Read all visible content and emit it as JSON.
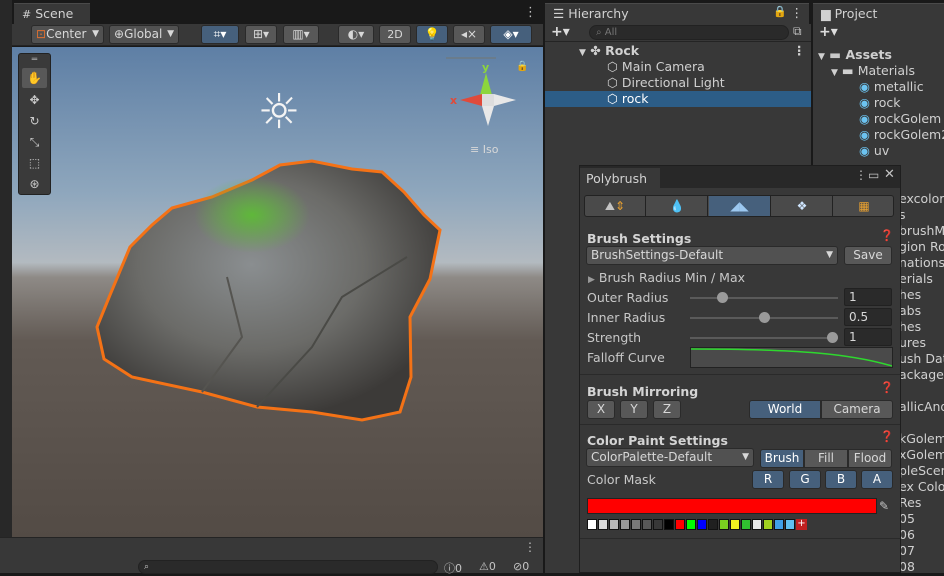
{
  "scene": {
    "tab_label": "Scene",
    "toolbar": {
      "pivot": "Center",
      "space": "Global",
      "mode_2d": "2D"
    },
    "gizmo": {
      "iso_label": "Iso",
      "y": "y",
      "x": "x"
    }
  },
  "hierarchy": {
    "tab_label": "Hierarchy",
    "search_placeholder": "All",
    "items": [
      {
        "label": "Rock"
      },
      {
        "label": "Main Camera"
      },
      {
        "label": "Directional Light"
      },
      {
        "label": "rock"
      }
    ]
  },
  "project": {
    "tab_label": "Project",
    "tree": [
      {
        "label": "Assets"
      },
      {
        "label": "Materials"
      },
      {
        "label": "metallic"
      },
      {
        "label": "rock"
      },
      {
        "label": "rockGolem"
      },
      {
        "label": "rockGolem2"
      },
      {
        "label": "uv"
      }
    ],
    "partial_items": [
      "excolor",
      "s",
      "brushMc",
      "gion Ro",
      "nations",
      "erials",
      "hes",
      "abs",
      "hes",
      "ures",
      "ush Data",
      "ackage",
      "",
      "allicAndS",
      "",
      "kGolem",
      "xGolem2",
      "pleScen",
      "ex Color",
      "Res",
      "05",
      "06",
      "07",
      "08"
    ]
  },
  "polybrush": {
    "title": "Polybrush",
    "brush_settings": {
      "heading": "Brush Settings",
      "preset": "BrushSettings-Default",
      "save": "Save",
      "radius_minmax": "Brush Radius Min / Max",
      "outer_radius_label": "Outer Radius",
      "outer_radius_value": "1",
      "outer_radius_fraction": 0.2,
      "inner_radius_label": "Inner Radius",
      "inner_radius_value": "0.5",
      "inner_radius_fraction": 0.5,
      "strength_label": "Strength",
      "strength_value": "1",
      "strength_fraction": 1.0,
      "falloff_label": "Falloff Curve"
    },
    "mirroring": {
      "heading": "Brush Mirroring",
      "x": "X",
      "y": "Y",
      "z": "Z",
      "world": "World",
      "camera": "Camera"
    },
    "color_paint": {
      "heading": "Color Paint Settings",
      "palette": "ColorPalette-Default",
      "brush": "Brush",
      "fill": "Fill",
      "flood": "Flood",
      "mask_label": "Color Mask",
      "r": "R",
      "g": "G",
      "b": "B",
      "a": "A",
      "current_color": "#ff0000",
      "swatches": [
        "#ffffff",
        "#d8d8d8",
        "#b8b8b8",
        "#989898",
        "#787878",
        "#585858",
        "#383838",
        "#000000",
        "#ff0000",
        "#00ff00",
        "#0000ff",
        "#202020",
        "#7ad020",
        "#f0f020",
        "#30c030",
        "#e8e8e8",
        "#a0d020",
        "#40a0e8",
        "#60c0f0"
      ]
    }
  },
  "console": {
    "warn_count": "0",
    "error_count": "0",
    "info_count": "0"
  },
  "colors": {
    "accent": "#46607c",
    "selection": "#2c5d87",
    "outline": "#f47216"
  }
}
